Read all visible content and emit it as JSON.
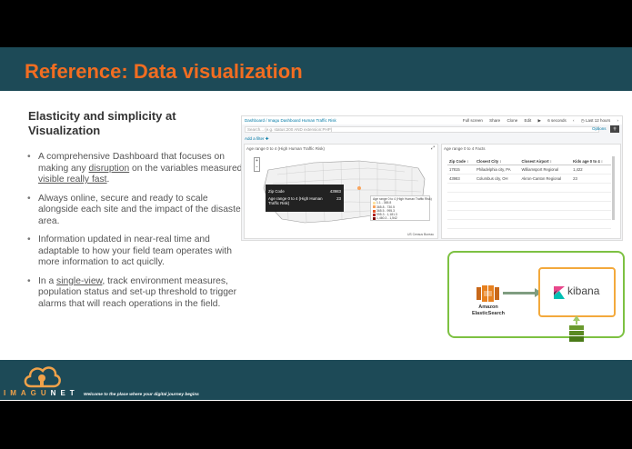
{
  "slide": {
    "title": "Reference: Data visualization",
    "subtitle": "Elasticity and simplicity at Visualization",
    "bullets": [
      {
        "pre": "A comprehensive Dashboard that focuses on making any ",
        "u1": "disruption",
        "mid": " on the variables measured, ",
        "u2": "visible really fast",
        "post": "."
      },
      {
        "text": "Always online, secure and ready to scale alongside each site and the impact of the disaster area."
      },
      {
        "text": "Information updated in near-real time and adaptable to how your field team operates with more information to act quiclly."
      },
      {
        "pre": "In a ",
        "u1": "single-view",
        "post": ", track environment measures, population status and set-up threshold to trigger alarms that will reach operations in the field."
      }
    ]
  },
  "dashboard": {
    "breadcrumb": "Dashboard / Imagu Dashboard Human Traffic Risk",
    "top_links": [
      "Full screen",
      "Share",
      "Clone",
      "Edit",
      "▶",
      "6 seconds",
      "‹",
      "◷ Last 12 hours",
      "›"
    ],
    "search_placeholder": "Search... (e.g. status:200 AND extension:PHP)",
    "options": "Options",
    "add_filter": "Add a filter ✚",
    "map_panel": {
      "title": "Age range 0 to 4 (High Human Traffic Risk)",
      "tooltip": {
        "zip_label": "Zip Code",
        "zip_value": "43983",
        "age_label": "Age range 0 to 4 (High Human Traffic Risk)",
        "age_value": "23"
      },
      "legend_title": "Age range 0 to 4 (High Human Traffic Risk)",
      "legend_items": [
        {
          "label": "1.1 - 365.8",
          "color": "#fde2a3"
        },
        {
          "label": "365.8 - 730.5",
          "color": "#f9a45c"
        },
        {
          "label": "365.5 - 995.3",
          "color": "#e4572e"
        },
        {
          "label": "995.3 - 1,181.3",
          "color": "#b22222"
        },
        {
          "label": "1,460.3 - 1,542",
          "color": "#7a0d0d"
        }
      ],
      "credit": "US Census Bureau"
    },
    "table_panel": {
      "title": "Age range 0 to 4 Facts",
      "columns": [
        "Zip Code ↕",
        "Closest City ↕",
        "Closest Airport ↕",
        "Kids age 0 to 4 ↕"
      ],
      "rows": [
        [
          "17815",
          "Philadelphia city, PA",
          "Williamsport Regional",
          "1,422"
        ],
        [
          "43983",
          "Columbus city, OH",
          "Akron-Canton Regional",
          "23"
        ]
      ]
    }
  },
  "architecture": {
    "source_label": "Amazon ElasticSearch",
    "target_label": "kibana",
    "colors": {
      "outer": "#7dc142",
      "inner": "#f3a93c",
      "aws": "#e7811f"
    }
  },
  "footer": {
    "brand_left": "IMAGU",
    "brand_right": "NET",
    "tagline": "Welcome to the place where your digital journey begins"
  }
}
